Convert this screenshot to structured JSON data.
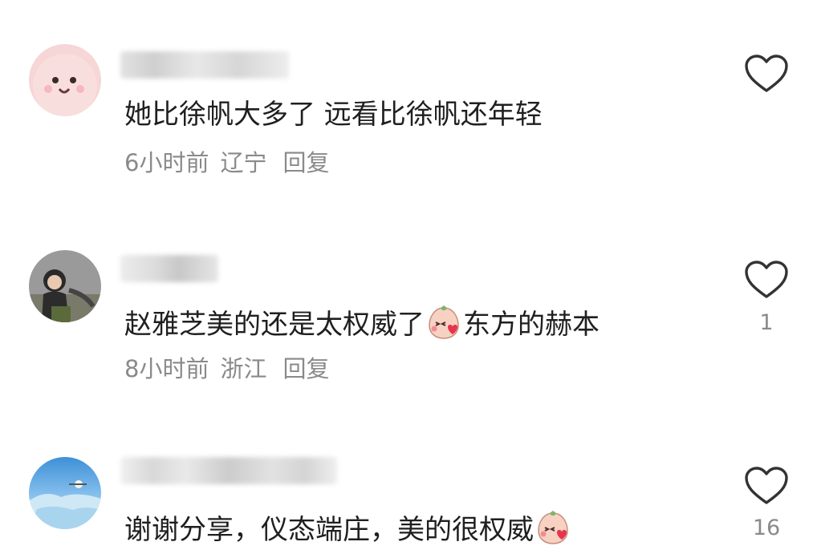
{
  "comments": [
    {
      "text_before": "她比徐帆大多了 远看比徐帆还年轻",
      "text_after": "",
      "emoji": "",
      "time": "6小时前",
      "location": "辽宁",
      "reply_label": "回复",
      "like_count": ""
    },
    {
      "text_before": "赵雅芝美的还是太权威了",
      "text_after": "东方的赫本",
      "emoji": "blush-kiss-emoji",
      "time": "8小时前",
      "location": "浙江",
      "reply_label": "回复",
      "like_count": "1"
    },
    {
      "text_before": "谢谢分享，仪态端庄，美的很权威",
      "text_after": "",
      "emoji": "blush-kiss-emoji",
      "like_count": "16"
    }
  ],
  "icons": {
    "like": "heart-outline-icon",
    "emoji": "blush-kiss-emoji"
  },
  "colors": {
    "text": "#1f1f1f",
    "meta": "#8a8a8a",
    "icon": "#333333"
  }
}
